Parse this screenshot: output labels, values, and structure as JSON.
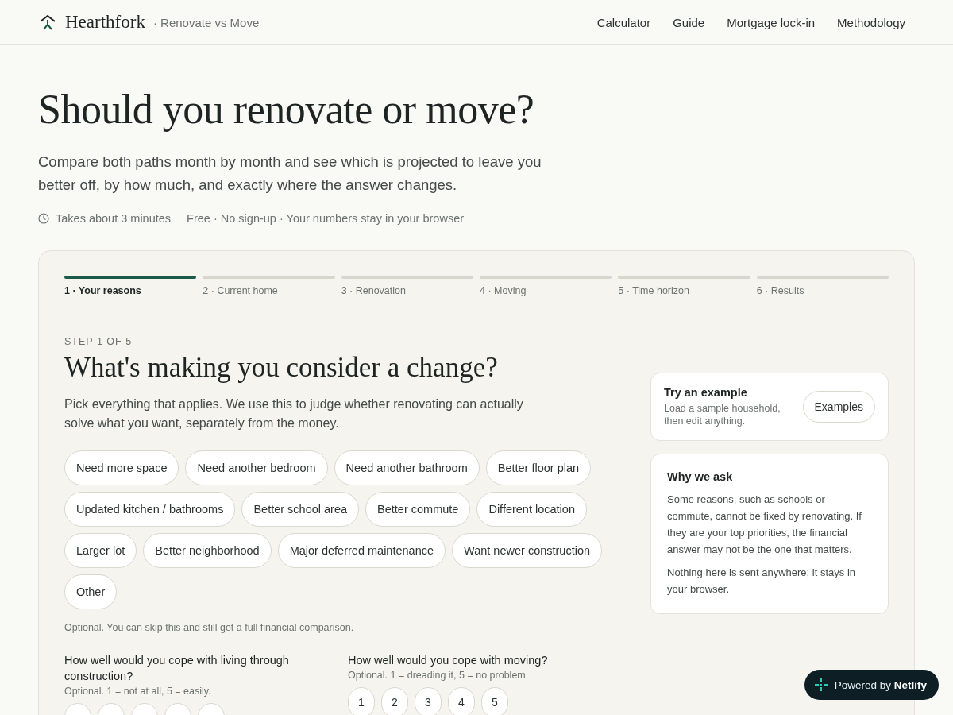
{
  "header": {
    "brand": "Hearthfork",
    "subtitle": "· Renovate vs Move",
    "nav": [
      {
        "label": "Calculator"
      },
      {
        "label": "Guide"
      },
      {
        "label": "Mortgage lock-in"
      },
      {
        "label": "Methodology"
      }
    ]
  },
  "hero": {
    "title": "Should you renovate or move?",
    "lead": "Compare both paths month by month and see which is projected to leave you better off, by how much, and exactly where the answer changes.",
    "time_note": "Takes about 3 minutes",
    "meta": "Free · No sign-up · Your numbers stay in your browser"
  },
  "steps": [
    {
      "label": "1 · Your reasons",
      "selected": true
    },
    {
      "label": "2 · Current home",
      "selected": false
    },
    {
      "label": "3 · Renovation",
      "selected": false
    },
    {
      "label": "4 · Moving",
      "selected": false
    },
    {
      "label": "5 · Time horizon",
      "selected": false
    },
    {
      "label": "6 · Results",
      "selected": false
    }
  ],
  "question": {
    "eyebrow": "STEP 1 OF 5",
    "title": "What's making you consider a change?",
    "intro": "Pick everything that applies. We use this to judge whether renovating can actually solve what you want, separately from the money.",
    "reasons": [
      {
        "label": "Need more space",
        "selected": false
      },
      {
        "label": "Need another bedroom",
        "selected": false
      },
      {
        "label": "Need another bathroom",
        "selected": false
      },
      {
        "label": "Better floor plan",
        "selected": false
      },
      {
        "label": "Updated kitchen / bathrooms",
        "selected": false
      },
      {
        "label": "Better school area",
        "selected": false
      },
      {
        "label": "Better commute",
        "selected": false
      },
      {
        "label": "Different location",
        "selected": false
      },
      {
        "label": "Larger lot",
        "selected": false
      },
      {
        "label": "Better neighborhood",
        "selected": false
      },
      {
        "label": "Major deferred maintenance",
        "selected": false
      },
      {
        "label": "Want newer construction",
        "selected": false
      },
      {
        "label": "Other",
        "selected": false
      }
    ],
    "note": "Optional. You can skip this and still get a full financial comparison."
  },
  "scales": [
    {
      "question": "How well would you cope with living through construction?",
      "hint": "Optional. 1 = not at all, 5 = easily.",
      "options": [
        {
          "selected": false
        },
        {
          "selected": false
        },
        {
          "selected": false
        },
        {
          "selected": false
        },
        {
          "selected": false
        }
      ]
    },
    {
      "question": "How well would you cope with moving?",
      "hint": "Optional. 1 = dreading it, 5 = no problem.",
      "options": [
        {
          "label": "1",
          "selected": false
        },
        {
          "label": "2",
          "selected": false
        },
        {
          "label": "3",
          "selected": false
        },
        {
          "label": "4",
          "selected": false
        },
        {
          "label": "5",
          "selected": false
        }
      ]
    }
  ],
  "example_card": {
    "title": "Try an example",
    "text": "Load a sample household, then edit anything.",
    "button": "Examples"
  },
  "why_card": {
    "title": "Why we ask",
    "paragraphs": [
      "Some reasons, such as schools or commute, cannot be fixed by renovating. If they are your top priorities, the financial answer may not be the one that matters.",
      "Nothing here is sent anywhere; it stays in your browser."
    ]
  },
  "badge": {
    "prefix": "Powered by",
    "brand": "Netlify"
  }
}
